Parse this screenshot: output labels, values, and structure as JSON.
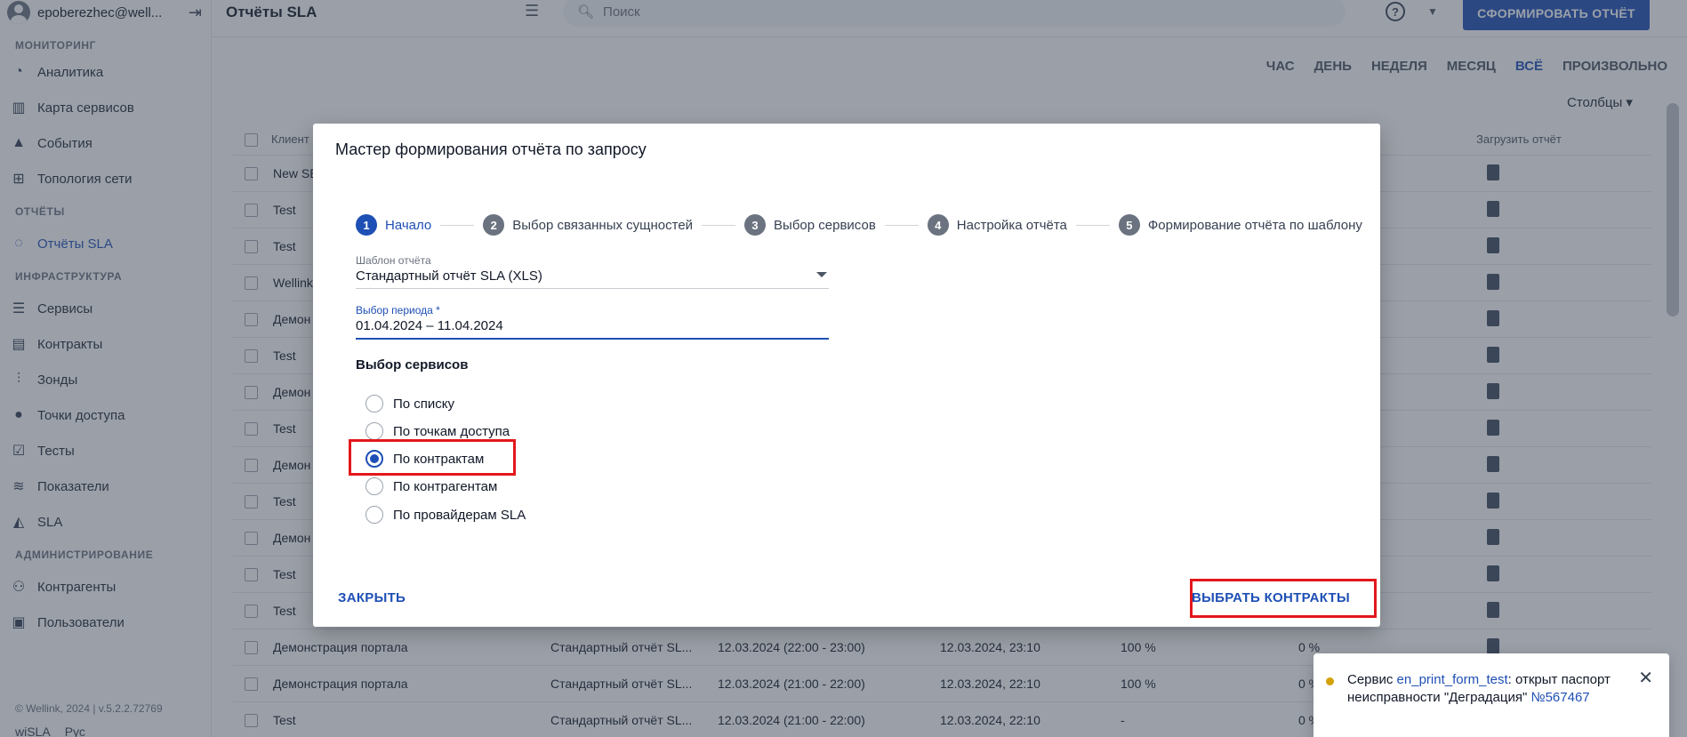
{
  "sidebar": {
    "user_email": "epoberezhec@well...",
    "sections": [
      {
        "title": "МОНИТОРИНГ",
        "items": [
          {
            "label": "Аналитика",
            "icon": "pie-chart-icon"
          },
          {
            "label": "Карта сервисов",
            "icon": "map-icon"
          },
          {
            "label": "События",
            "icon": "warning-icon"
          },
          {
            "label": "Топология сети",
            "icon": "topology-icon"
          }
        ]
      },
      {
        "title": "ОТЧЁТЫ",
        "items": [
          {
            "label": "Отчёты SLA",
            "icon": "reports-icon"
          }
        ]
      },
      {
        "title": "ИНФРАСТРУКТУРА",
        "items": [
          {
            "label": "Сервисы",
            "icon": "list-icon"
          },
          {
            "label": "Контракты",
            "icon": "document-icon"
          },
          {
            "label": "Зонды",
            "icon": "probe-icon"
          },
          {
            "label": "Точки доступа",
            "icon": "access-point-icon"
          },
          {
            "label": "Тесты",
            "icon": "tests-icon"
          },
          {
            "label": "Показатели",
            "icon": "metrics-icon"
          },
          {
            "label": "SLA",
            "icon": "sla-icon"
          }
        ]
      },
      {
        "title": "АДМИНИСТРИРОВАНИЕ",
        "items": [
          {
            "label": "Контрагенты",
            "icon": "people-icon"
          },
          {
            "label": "Пользователи",
            "icon": "user-card-icon"
          }
        ]
      }
    ],
    "footer": "© Wellink, 2024 | v.5.2.2.72769",
    "footer_logo": "wiSLA",
    "footer_lang": "Рус"
  },
  "header": {
    "title": "Отчёты SLA",
    "search_placeholder": "Поиск",
    "help_icon": "?",
    "create_button": "СФОРМИРОВАТЬ ОТЧЁТ"
  },
  "period_tabs": [
    "ЧАС",
    "ДЕНЬ",
    "НЕДЕЛЯ",
    "МЕСЯЦ",
    "ВСЁ",
    "ПРОИЗВОЛЬНО"
  ],
  "columns_button": "Столбцы",
  "table": {
    "headers": {
      "client": "Клиент",
      "download": "Загрузить отчёт"
    },
    "rows": [
      {
        "client": "New SE"
      },
      {
        "client": "Test"
      },
      {
        "client": "Test"
      },
      {
        "client": "Wellink"
      },
      {
        "client": "Демон"
      },
      {
        "client": "Test"
      },
      {
        "client": "Демон"
      },
      {
        "client": "Test"
      },
      {
        "client": "Демон"
      },
      {
        "client": "Test"
      },
      {
        "client": "Демон"
      },
      {
        "client": "Test"
      },
      {
        "client": "Test"
      },
      {
        "client": "Демонстрация портала",
        "template": "Стандартный отчёт SL...",
        "period": "12.03.2024 (22:00 - 23:00)",
        "created": "12.03.2024, 23:10",
        "value": "100 %",
        "value2": "0 %"
      },
      {
        "client": "Демонстрация портала",
        "template": "Стандартный отчёт SL...",
        "period": "12.03.2024 (21:00 - 22:00)",
        "created": "12.03.2024, 22:10",
        "value": "100 %",
        "value2": "0 %"
      },
      {
        "client": "Test",
        "template": "Стандартный отчёт SL...",
        "period": "12.03.2024 (21:00 - 22:00)",
        "created": "12.03.2024, 22:10",
        "value": "-",
        "value2": "0 %"
      }
    ]
  },
  "modal": {
    "title": "Мастер формирования отчёта по запросу",
    "steps": [
      {
        "num": "1",
        "label": "Начало"
      },
      {
        "num": "2",
        "label": "Выбор связанных сущностей"
      },
      {
        "num": "3",
        "label": "Выбор сервисов"
      },
      {
        "num": "4",
        "label": "Настройка отчёта"
      },
      {
        "num": "5",
        "label": "Формирование отчёта по шаблону"
      }
    ],
    "template_label": "Шаблон отчёта",
    "template_value": "Стандартный отчёт SLA (XLS)",
    "period_label": "Выбор периода *",
    "period_value": "01.04.2024 – 11.04.2024",
    "services_title": "Выбор сервисов",
    "options": [
      "По списку",
      "По точкам доступа",
      "По контрактам",
      "По контрагентам",
      "По провайдерам SLA"
    ],
    "selected_option": "По контрактам",
    "close_button": "ЗАКРЫТЬ",
    "choose_button": "ВЫБРАТЬ КОНТРАКТЫ"
  },
  "toast": {
    "prefix": "Сервис ",
    "service_link": "en_print_form_test",
    "middle": ": открыт паспорт неисправности \"Деградация\" ",
    "ticket_link": "№567467"
  },
  "colors": {
    "accent": "#1e4fb5",
    "highlight": "#e3171c",
    "toast_dot": "#d4a106"
  }
}
